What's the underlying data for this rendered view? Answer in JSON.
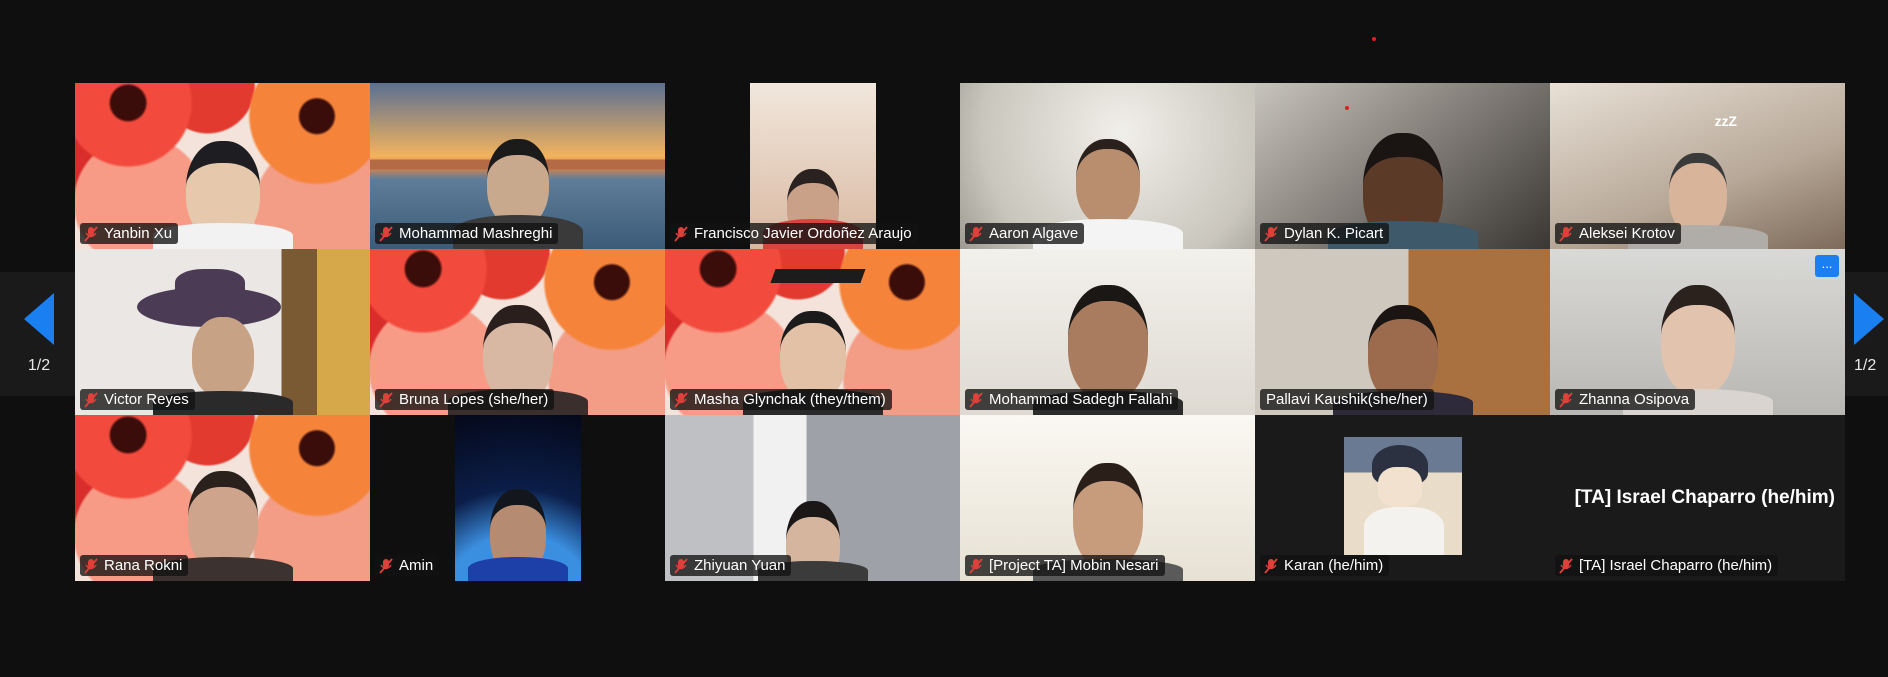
{
  "window": {
    "page_indicator_left": "1/2",
    "page_indicator_right": "1/2"
  },
  "colors": {
    "accent": "#1a7ff0",
    "active_speaker_border": "#c8de6a",
    "muted_icon": "#e0403a",
    "background": "#0f0f10"
  },
  "participants": [
    {
      "name": "Yanbin Xu",
      "muted": true
    },
    {
      "name": "Mohammad Mashreghi",
      "muted": true
    },
    {
      "name": "Francisco Javier Ordoñez Araujo",
      "muted": true
    },
    {
      "name": "Aaron Algave",
      "muted": true
    },
    {
      "name": "Dylan K. Picart",
      "muted": true
    },
    {
      "name": "Aleksei Krotov",
      "muted": true
    },
    {
      "name": "Victor Reyes",
      "muted": true
    },
    {
      "name": "Bruna Lopes (she/her)",
      "muted": true
    },
    {
      "name": "Masha Glynchak (they/them)",
      "muted": true
    },
    {
      "name": "Mohammad Sadegh Fallahi",
      "muted": true
    },
    {
      "name": "Pallavi Kaushik(she/her)",
      "muted": false,
      "active_speaker": true
    },
    {
      "name": "Zhanna Osipova",
      "muted": true,
      "more_button": "..."
    },
    {
      "name": "Rana Rokni",
      "muted": true
    },
    {
      "name": "Amin",
      "muted": true
    },
    {
      "name": "Zhiyuan Yuan",
      "muted": true
    },
    {
      "name": "[Project TA] Mobin Nesari",
      "muted": true
    },
    {
      "name": "Karan (he/him)",
      "muted": true
    },
    {
      "name": "[TA] Israel Chaparro (he/him)",
      "muted": true,
      "video_off": true,
      "display_name": "[TA] Israel Chaparro (he/him)"
    }
  ],
  "icons": {
    "muted": "muted-microphone-icon",
    "prev": "previous-page-arrow-icon",
    "next": "next-page-arrow-icon",
    "more": "more-options-icon"
  }
}
